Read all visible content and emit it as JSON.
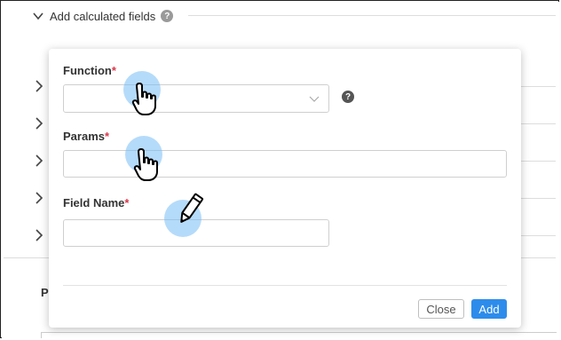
{
  "section": {
    "title": "Add calculated fields",
    "help": "?"
  },
  "background": {
    "partial_label": "P"
  },
  "modal": {
    "function_label": "Function",
    "params_label": "Params",
    "field_name_label": "Field Name",
    "required_marker": "*",
    "function_value": "",
    "params_value": "",
    "field_name_value": "",
    "help": "?",
    "close_label": "Close",
    "add_label": "Add"
  },
  "colors": {
    "accent": "#2d8ceb",
    "required": "#d9364a",
    "cursor_highlight": "#78bef5"
  },
  "icons": [
    "chevron-down-icon",
    "chevron-right-icon",
    "help-icon",
    "hand-pointer-icon",
    "pencil-icon"
  ]
}
